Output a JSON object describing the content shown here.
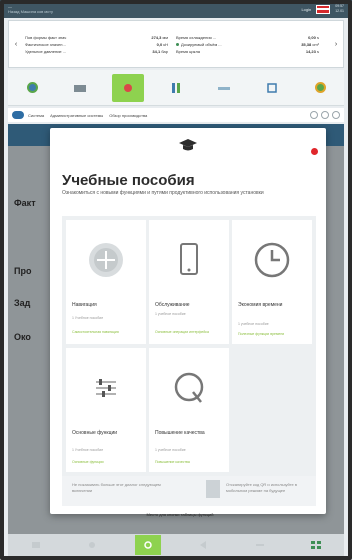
{
  "header": {
    "title_line1": "—",
    "title_line2": "Назад Машина ков мсту",
    "login": "Login",
    "time_line1": "09:57",
    "time_line2": "12.01",
    "colors": {
      "bar": "#3f5663",
      "flag_red": "#d6292c"
    }
  },
  "stats": {
    "left_arrow": "‹",
    "right_arrow": "›",
    "col1": [
      {
        "label": "Пов формы факт знач",
        "value": "274,3",
        "unit": "мм"
      },
      {
        "label": "Фактическое значен...",
        "value": "0,0",
        "unit": "кН"
      },
      {
        "label": "Удельное давление ...",
        "value": "34,1",
        "unit": "бар"
      }
    ],
    "col2": [
      {
        "label": "Время охлаждения ...",
        "value": "0,00",
        "unit": "s"
      },
      {
        "label": "Дозируемый объём ...",
        "value": "35,38",
        "unit": "cm³"
      },
      {
        "label": "Время цикла",
        "value": "14,23",
        "unit": "s"
      }
    ]
  },
  "toolbar": {
    "items": [
      {
        "name": "machine-status-icon"
      },
      {
        "name": "mold-icon"
      },
      {
        "name": "injection-icon",
        "active": true
      },
      {
        "name": "clamp-icon"
      },
      {
        "name": "temperature-icon"
      },
      {
        "name": "setup-icon"
      },
      {
        "name": "status-green-icon"
      }
    ],
    "accent": "#8ed24f"
  },
  "breadcrumb": {
    "items": [
      "Система",
      "Административные системы",
      "Обзор производства"
    ]
  },
  "background_labels": {
    "label1": "Факт",
    "label2": "Про",
    "label3": "Зад",
    "label4": "Око"
  },
  "modal": {
    "title": "Учебные пособия",
    "subtitle": "Ознакомиться с новыми функциями и путями продуктивного использования установки",
    "cards": [
      {
        "title": "Навигация",
        "meta": "1 Учебное пособие",
        "link": "Самостоятельная навигация",
        "icon": "navigation-icon"
      },
      {
        "title": "Обслуживание",
        "meta": "1 учебное пособие",
        "link": "Основные операции интерфейса",
        "icon": "tablet-icon"
      },
      {
        "title": "Экономия времени",
        "meta": "1 учебное пособие",
        "link": "Полезные функции времени",
        "icon": "clock-icon"
      },
      {
        "title": "Основные функции",
        "meta": "1 Учебное пособие",
        "link": "Основные функции",
        "icon": "sliders-icon"
      },
      {
        "title": "Повышение качества",
        "meta": "1 учебное пособие",
        "link": "Повышение качества",
        "icon": "quality-icon"
      }
    ],
    "footer_left": "Не показывать больше этот диалог следующем включении",
    "footer_right": "Отсканируйте код QR и используйте в мобильном режиме на будущее"
  },
  "bottom_note": "Место для кнопки таблицы функций",
  "bottom_bar": {
    "items": [
      "flow-icon",
      "gear-icon",
      "settings-icon",
      "arrow-icon",
      "wrench-icon",
      "grid-icon"
    ],
    "active_index": 2
  }
}
